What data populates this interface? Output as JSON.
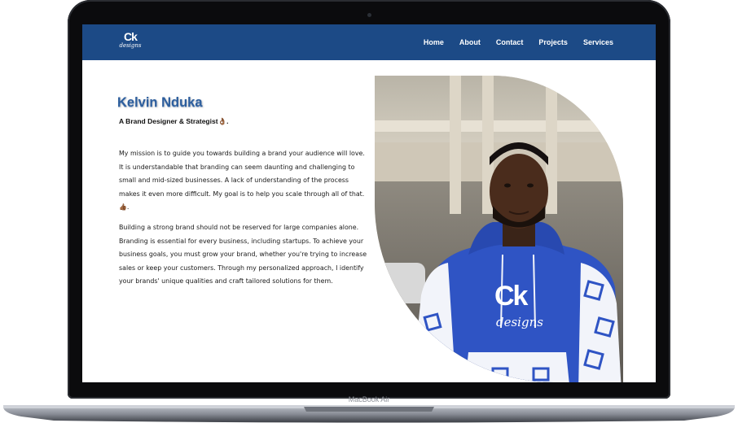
{
  "laptop": {
    "model_label": "MacBook Air"
  },
  "site": {
    "logo": {
      "main": "Ck",
      "sub": "designs"
    },
    "nav": [
      "Home",
      "About",
      "Contact",
      "Projects",
      "Services"
    ],
    "hero": {
      "name": "Kelvin Nduka",
      "tagline": "A Brand Designer & Strategist👌🏾.",
      "paragraphs": [
        "My mission is to guide you towards building a brand your audience will love. It is understandable that branding can seem daunting and challenging to small and mid-sized businesses. A lack of understanding of the process makes it even more difficult. My goal is to help you scale through all of that.👍🏾.",
        "Building a strong brand should not be reserved for large companies alone. Branding is essential for every business, including startups. To achieve your business goals, you must grow your brand, whether you're trying to increase sales or keep your customers. Through my personalized approach, I identify your brands' unique qualities and craft tailored solutions for them."
      ],
      "hoodie_logo": {
        "main": "Ck",
        "sub": "designs"
      }
    }
  },
  "colors": {
    "nav_bg": "#1c4a86",
    "name": "#2d5e9d",
    "hoodie": "#2f54c4"
  }
}
